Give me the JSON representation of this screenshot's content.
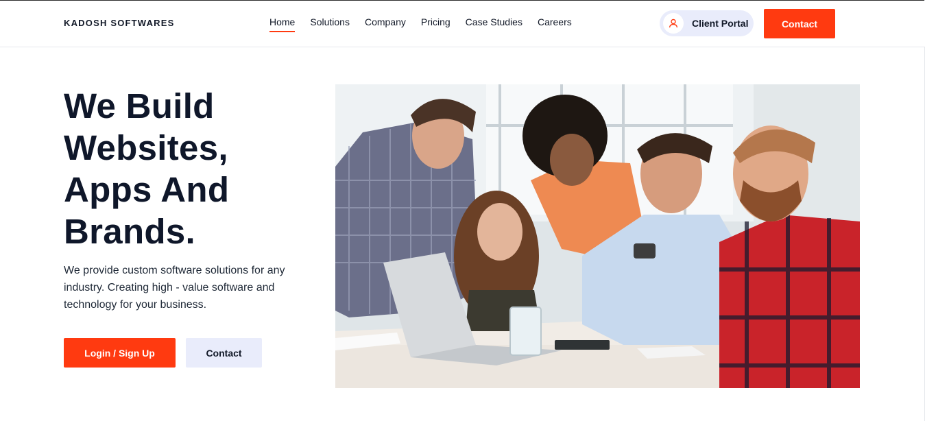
{
  "brand": {
    "name": "KADOSH SOFTWARES"
  },
  "nav": {
    "items": [
      {
        "label": "Home",
        "active": true
      },
      {
        "label": "Solutions",
        "active": false
      },
      {
        "label": "Company",
        "active": false
      },
      {
        "label": "Pricing",
        "active": false
      },
      {
        "label": "Case Studies",
        "active": false
      },
      {
        "label": "Careers",
        "active": false
      }
    ]
  },
  "header": {
    "client_portal": {
      "label": "Client Portal",
      "icon": "user-icon"
    },
    "contact_label": "Contact"
  },
  "hero": {
    "title": "We Build Websites, Apps And Brands.",
    "description": "We provide custom software solutions for any industry. Creating high - value software and technology for your business.",
    "primary_button": "Login / Sign Up",
    "secondary_button": "Contact"
  },
  "colors": {
    "accent": "#ff3a10",
    "soft_button": "#e9ecfb",
    "heading": "#0f172a"
  }
}
